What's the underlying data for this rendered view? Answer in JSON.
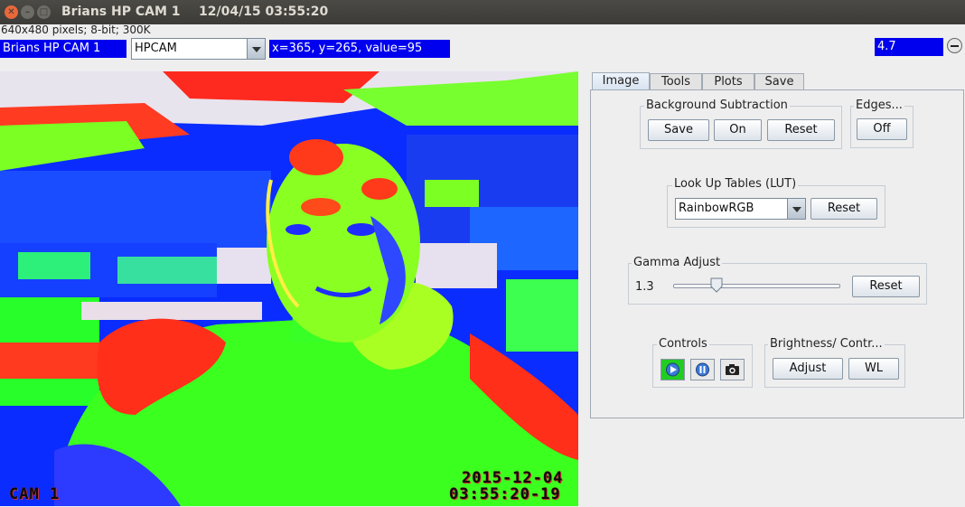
{
  "window": {
    "title": "Brians HP CAM 1",
    "datetime": "12/04/15 03:55:20"
  },
  "info_line": "640x480 pixels; 8-bit; 300K",
  "toolbar": {
    "camera_name": "Brians HP CAM 1",
    "camera_select": "HPCAM",
    "pixel_readout": "x=365, y=265, value=95",
    "zoom_value": "4.7"
  },
  "camera": {
    "osd_label": "CAM 1",
    "osd_date": "2015-12-04",
    "osd_time": "03:55:20-19"
  },
  "tabs": [
    {
      "label": "Image",
      "active": true
    },
    {
      "label": "Tools",
      "active": false
    },
    {
      "label": "Plots",
      "active": false
    },
    {
      "label": "Save",
      "active": false
    }
  ],
  "background_subtraction": {
    "title": "Background Subtraction",
    "save": "Save",
    "on": "On",
    "reset": "Reset"
  },
  "edges": {
    "title": "Edges...",
    "off": "Off"
  },
  "lut": {
    "title": "Look Up Tables (LUT)",
    "selected": "RainbowRGB",
    "reset": "Reset"
  },
  "gamma": {
    "title": "Gamma Adjust",
    "value_text": "1.3",
    "slider_fraction": 0.24,
    "reset": "Reset"
  },
  "controls": {
    "title": "Controls",
    "icons": [
      "play-icon",
      "pause-icon",
      "camera-icon"
    ]
  },
  "brightness": {
    "title": "Brightness/ Contr...",
    "adjust": "Adjust",
    "wl": "WL"
  },
  "colors": {
    "field_blue": "#0000ee",
    "title_bar": "#3c3b37",
    "play_green": "#22cc22"
  }
}
